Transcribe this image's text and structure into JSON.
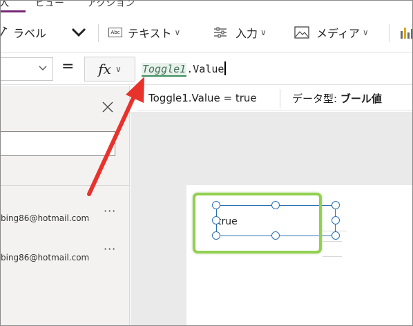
{
  "top_menu": {
    "tabs": [
      {
        "label": "挿入"
      },
      {
        "label": "ビュー"
      },
      {
        "label": "アクション"
      }
    ]
  },
  "ribbon": {
    "label_btn": "ラベル",
    "text_btn": "テキスト",
    "input_btn": "入力",
    "media_btn": "メディア",
    "text_icon_caption": "Abc"
  },
  "formula_bar": {
    "equals": "=",
    "fx": "fx",
    "token": "Toggle1",
    "rest": ".Value"
  },
  "result": {
    "expression": "Toggle1.Value  =  true",
    "type_label": "データ型:",
    "type_value": "ブール値"
  },
  "left_panel": {
    "items": [
      {
        "email": "bing86@hotmail.com",
        "more": "···"
      },
      {
        "email": "bing86@hotmail.com",
        "more": "···"
      }
    ]
  },
  "canvas": {
    "label_text": "true"
  },
  "colors": {
    "accent": "#742774",
    "highlight_green": "#92d050",
    "selection_blue": "#2b6fb5",
    "arrow_red": "#e8322c",
    "token_green": "#46735c"
  }
}
